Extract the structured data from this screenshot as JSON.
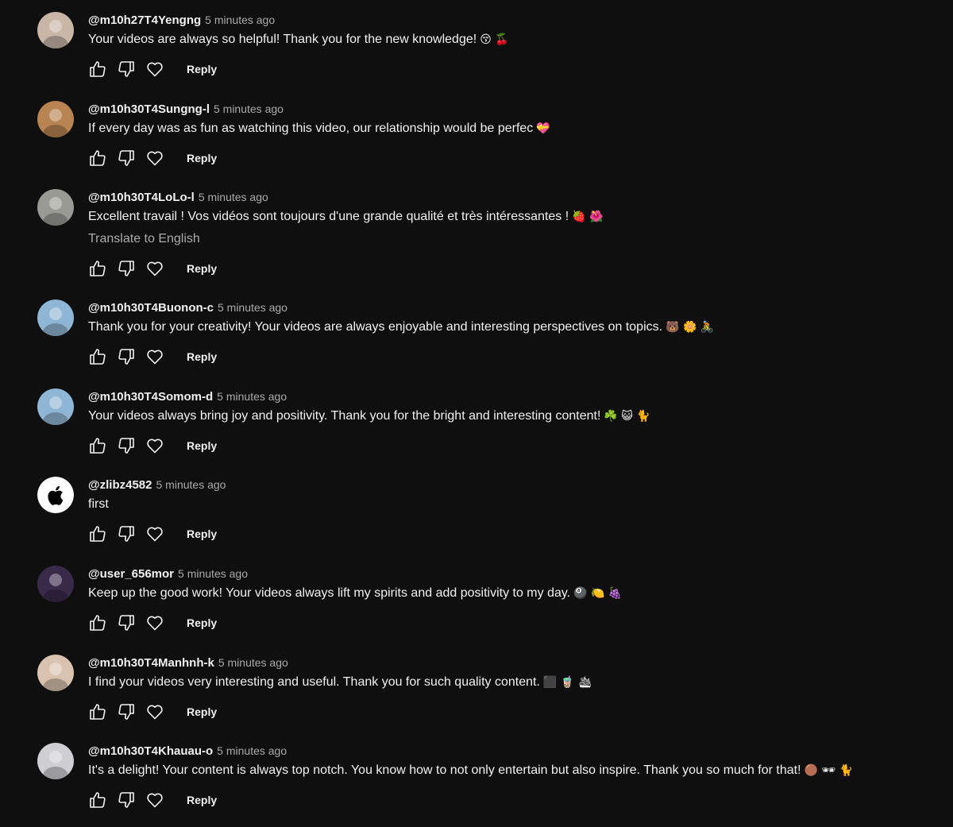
{
  "reply_label": "Reply",
  "translate_label": "Translate to English",
  "comments": [
    {
      "author": "@m10h27T4Yengng",
      "time": "5 minutes ago",
      "text": "Your videos are always so helpful! Thank you for the new knowledge!",
      "emojis": "😚 🍒",
      "avatar_color": "#c8b6a6",
      "avatar_icon": "photo-avatar"
    },
    {
      "author": "@m10h30T4Sungng-l",
      "time": "5 minutes ago",
      "text": "If every day was as fun as watching this video, our relationship would be perfec",
      "emojis": "💝",
      "avatar_color": "#b88452",
      "avatar_icon": "photo-avatar"
    },
    {
      "author": "@m10h30T4LoLo-l",
      "time": "5 minutes ago",
      "text": "Excellent travail ! Vos vidéos sont toujours d'une grande qualité et très intéressantes !",
      "emojis": "🍓 🌺",
      "avatar_color": "#9a9a94",
      "avatar_icon": "photo-avatar",
      "translatable": true
    },
    {
      "author": "@m10h30T4Buonon-c",
      "time": "5 minutes ago",
      "text": "Thank you for your creativity! Your videos are always enjoyable and interesting perspectives on topics.",
      "emojis": "🐻 🌼 🚴",
      "avatar_color": "#8fb6d4",
      "avatar_icon": "photo-avatar"
    },
    {
      "author": "@m10h30T4Somom-d",
      "time": "5 minutes ago",
      "text": "Your videos always bring joy and positivity. Thank you for the bright and interesting content!",
      "emojis": "☘️ 😺 🐈",
      "avatar_color": "#8fb6d4",
      "avatar_icon": "photo-avatar"
    },
    {
      "author": "@zlibz4582",
      "time": "5 minutes ago",
      "text": "first",
      "emojis": "",
      "avatar_color": "#ffffff",
      "avatar_icon": "apple-logo-avatar"
    },
    {
      "author": "@user_656mor",
      "time": "5 minutes ago",
      "text": "Keep up the good work! Your videos always lift my spirits and add positivity to my day.",
      "emojis": "🎱 🍋 🍇",
      "avatar_color": "#3a2a4a",
      "avatar_icon": "photo-avatar"
    },
    {
      "author": "@m10h30T4Manhnh-k",
      "time": "5 minutes ago",
      "text": "I find your videos very interesting and useful. Thank you for such quality content.",
      "emojis": "⬛ 🧋 🛳",
      "avatar_color": "#d9c3b0",
      "avatar_icon": "photo-avatar"
    },
    {
      "author": "@m10h30T4Khauau-o",
      "time": "5 minutes ago",
      "text": "It's a delight! Your content is always top notch. You know how to not only entertain but also inspire. Thank you so much for that!",
      "emojis": "🟤 🕶 🐈",
      "avatar_color": "#cfcfd3",
      "avatar_icon": "photo-avatar"
    }
  ]
}
